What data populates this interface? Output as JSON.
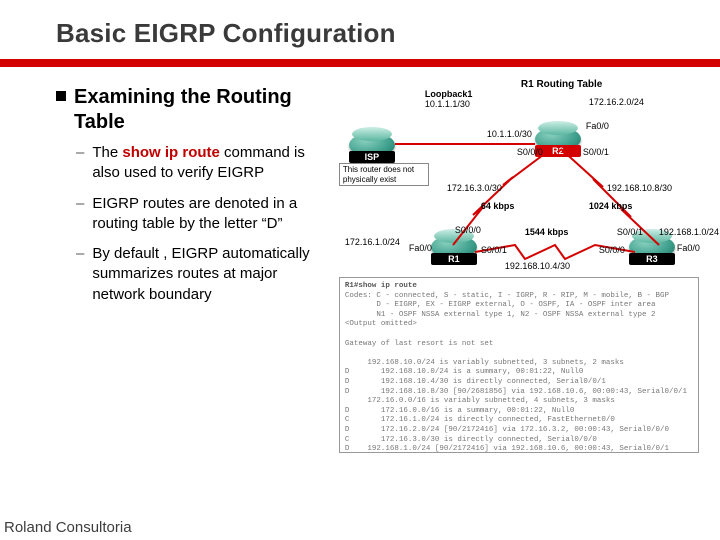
{
  "title": "Basic EIGRP Configuration",
  "section_heading": "Examining the Routing Table",
  "bullets": [
    {
      "pre": "The ",
      "cmd": "show ip route",
      "post": " command is also used to verify EIGRP"
    },
    {
      "pre": "EIGRP routes are denoted in a routing table by the letter “D”",
      "cmd": "",
      "post": ""
    },
    {
      "pre": "By default , EIGRP automatically summarizes routes at major network boundary",
      "cmd": "",
      "post": ""
    }
  ],
  "diagram": {
    "rt_title": "R1 Routing Table",
    "loopback_lbl": "Loopback1",
    "loopback_ip": "10.1.1.1/30",
    "isp": "ISP",
    "r1": "R1",
    "r2": "R2",
    "r3": "R3",
    "note": "This router does not physically exist",
    "ip_10_1_1_0": "10.1.1.0/30",
    "ip_172_16_2": "172.16.2.0/24",
    "fa00": "Fa0/0",
    "s000": "S0/0/0",
    "s001": "S0/0/1",
    "ip_172_16_3": "172.16.3.0/30",
    "ip_192_168_10_8": "192.168.10.8/30",
    "kbps64": "64 kbps",
    "kbps1024": "1024 kbps",
    "kbps1544": "1544 kbps",
    "ip_172_16_1": "172.16.1.0/24",
    "ip_192_168_10_4": "192.168.10.4/30",
    "ip_192_168_1": "192.168.1.0/24"
  },
  "terminal": {
    "prompt": "R1#show ip route",
    "legend1": "Codes: C - connected, S - static, I - IGRP, R - RIP, M - mobile, B - BGP",
    "legend2": "       D - EIGRP, EX - EIGRP external, O - OSPF, IA - OSPF inter area",
    "legend3": "       N1 - OSPF NSSA external type 1, N2 - OSPF NSSA external type 2",
    "legend4": "<Output omitted>",
    "gw": "Gateway of last resort is not set",
    "l1": "     192.168.10.0/24 is variably subnetted, 3 subnets, 2 masks",
    "l2": "D       192.168.10.0/24 is a summary, 00:01:22, Null0",
    "l3": "D       192.168.10.4/30 is directly connected, Serial0/0/1",
    "l4": "D       192.168.10.8/30 [90/2681856] via 192.168.10.6, 00:00:43, Serial0/0/1",
    "l5": "     172.16.0.0/16 is variably subnetted, 4 subnets, 3 masks",
    "l6": "D       172.16.0.0/16 is a summary, 00:01:22, Null0",
    "l7": "C       172.16.1.0/24 is directly connected, FastEthernet0/0",
    "l8": "D       172.16.2.0/24 [90/2172416] via 172.16.3.2, 00:00:43, Serial0/0/0",
    "l9": "C       172.16.3.0/30 is directly connected, Serial0/0/0",
    "l10": "D    192.168.1.0/24 [90/2172416] via 192.168.10.6, 00:00:43, Serial0/0/1"
  },
  "footer": "Roland Consultoria"
}
